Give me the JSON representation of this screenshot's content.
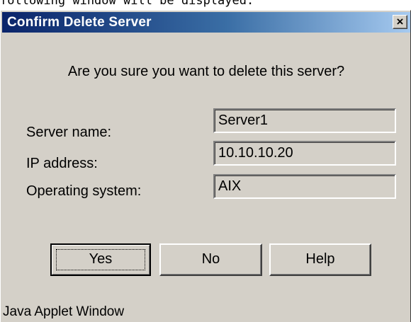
{
  "caption": "following window will be displayed.",
  "dialog": {
    "title": "Confirm Delete Server",
    "close_glyph": "×",
    "question": "Are you sure you want to delete this server?",
    "fields": [
      {
        "label": "Server name:",
        "value": "Server1"
      },
      {
        "label": "IP address:",
        "value": "10.10.10.20"
      },
      {
        "label": "Operating system:",
        "value": "AIX"
      }
    ],
    "buttons": {
      "yes": "Yes",
      "no": "No",
      "help": "Help"
    },
    "status": "Java Applet Window"
  },
  "colors": {
    "window_bg": "#d4d0c8",
    "titlebar_start": "#0a246a",
    "titlebar_end": "#a6caf0"
  }
}
